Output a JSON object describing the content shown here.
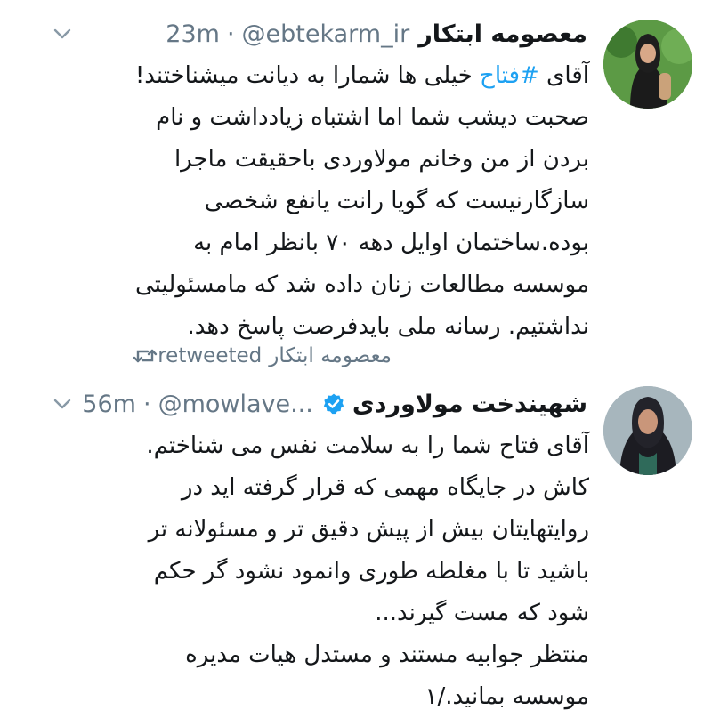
{
  "tweets": [
    {
      "display_name": "معصومه ابتکار",
      "handle": "@ebtekarm_ir",
      "separator": "·",
      "time": "23m",
      "hashtag": "#فتاح",
      "text_before_hashtag": "آقای ",
      "text_after_hashtag": " خیلی ها شمارا به دیانت میشناختند!\nصحبت دیشب شما اما اشتباه زیادداشت و نام بردن از من وخانم مولاوردی باحقیقت ماجرا سازگارنیست که گویا رانت یانفع شخصی بوده.ساختمان اوایل دهه ۷۰ بانظر امام به موسسه مطالعات زنان داده شد که مامسئولیتی نداشتیم. رسانه ملی بایدفرصت پاسخ دهد."
    },
    {
      "display_name": "شهیندخت مولاوردی",
      "handle": "@mowlave...",
      "separator": "·",
      "time": "56m",
      "text": "آقای فتاح شما را به سلامت نفس می شناختم. کاش در جایگاه مهمی که قرار گرفته اید در روایتهایتان بیش از پیش دقیق تر و مسئولانه تر باشید تا با مغلطه طوری وانمود نشود گر حکم شود که مست گیرند...\nمنتظر جوابیه مستند و مستدل هیات مدیره موسسه بمانید./۱"
    }
  ],
  "retweet_banner": {
    "name": "معصومه ابتکار",
    "label": "retweeted"
  },
  "colors": {
    "text": "#14171a",
    "secondary": "#657786",
    "link": "#1da1f2",
    "verified": "#1da1f2"
  },
  "icons": {
    "caret": "chevron-down-icon",
    "retweet": "retweet-icon",
    "verified": "verified-badge-icon"
  }
}
